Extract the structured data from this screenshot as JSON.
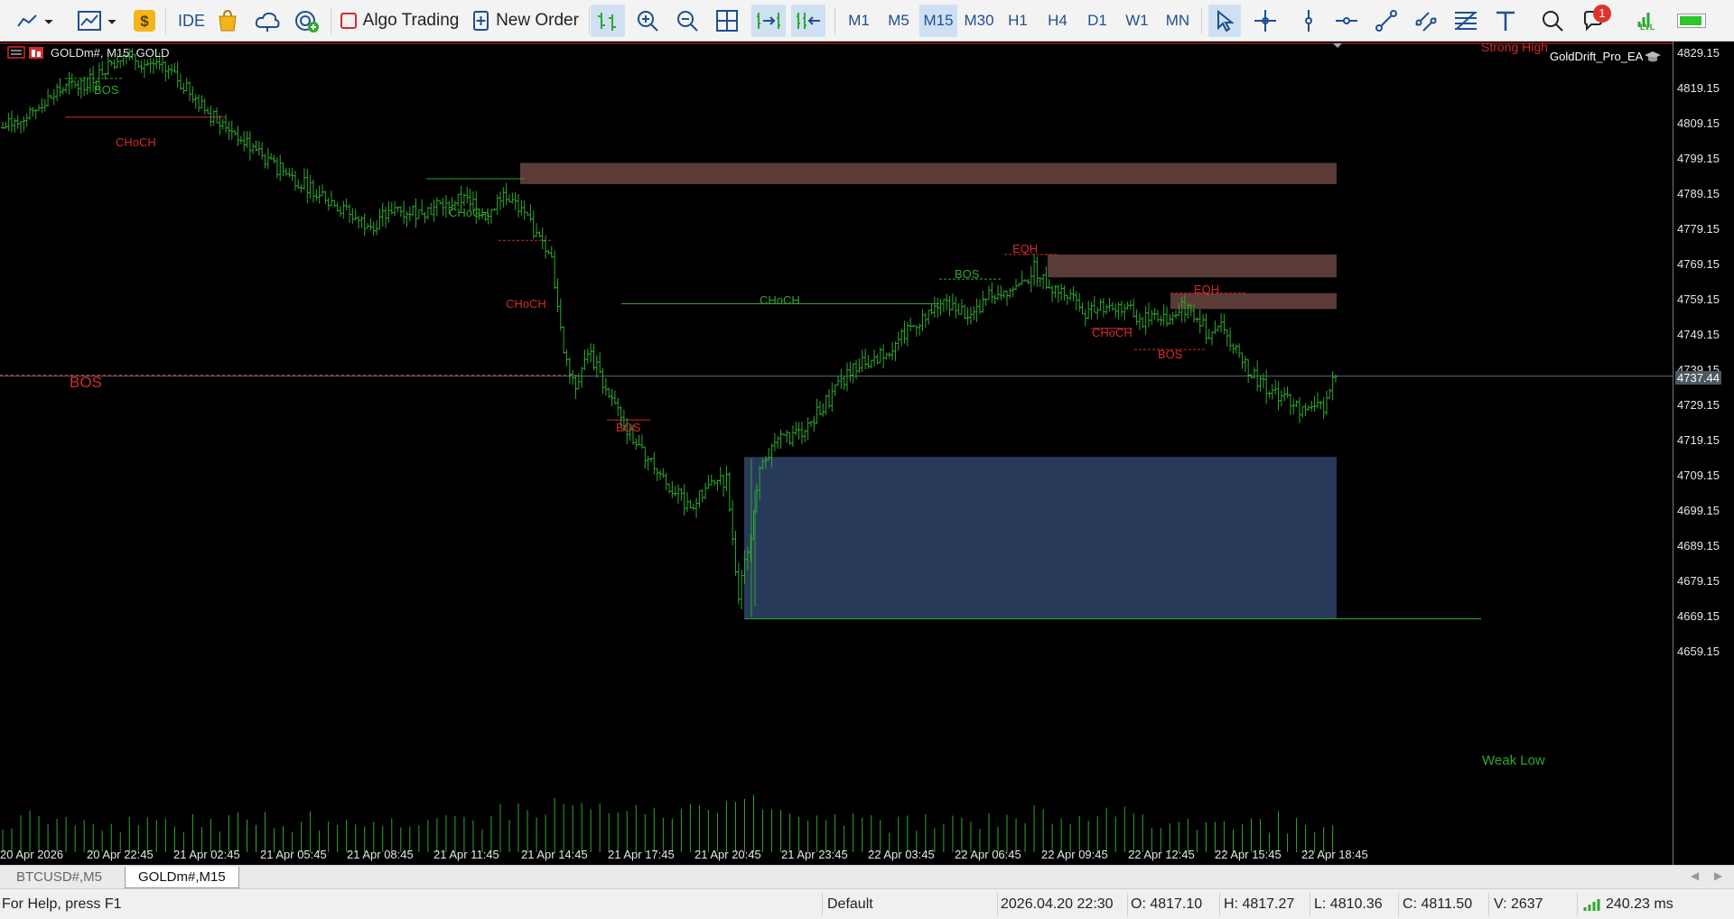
{
  "toolbar": {
    "algo_trading": "Algo Trading",
    "new_order": "New Order",
    "ide": "IDE",
    "timeframes": [
      "M1",
      "M5",
      "M15",
      "M30",
      "H1",
      "H4",
      "D1",
      "W1",
      "MN"
    ],
    "active_timeframe": "M15",
    "notification_count": "1",
    "lvl": "LVL"
  },
  "chart": {
    "title": "GOLDm#, M15:  GOLD",
    "ea_name": "GoldDrift_Pro_EA",
    "strong_high": "Strong High",
    "weak_low": "Weak Low",
    "current_price": "4737.44",
    "bull_color": "#2ea82e",
    "bear_color": "#d42b2b",
    "zone_color": "#5a3b37",
    "demand_zone_color": "#283a5a",
    "labels": {
      "bos": "BOS",
      "choch": "CHoCH",
      "eqh": "EQH"
    }
  },
  "price_scale": [
    "4829.15",
    "4819.15",
    "4809.15",
    "4799.15",
    "4789.15",
    "4779.15",
    "4769.15",
    "4759.15",
    "4749.15",
    "4739.15",
    "4729.15",
    "4719.15",
    "4709.15",
    "4699.15",
    "4689.15",
    "4679.15",
    "4669.15",
    "4659.15"
  ],
  "time_scale": [
    "20 Apr 2026",
    "20 Apr 22:45",
    "21 Apr 02:45",
    "21 Apr 05:45",
    "21 Apr 08:45",
    "21 Apr 11:45",
    "21 Apr 14:45",
    "21 Apr 17:45",
    "21 Apr 20:45",
    "21 Apr 23:45",
    "22 Apr 03:45",
    "22 Apr 06:45",
    "22 Apr 09:45",
    "22 Apr 12:45",
    "22 Apr 15:45",
    "22 Apr 18:45"
  ],
  "tabs": [
    "BTCUSD#,M5",
    "GOLDm#,M15"
  ],
  "active_tab": "GOLDm#,M15",
  "status": {
    "help": "For Help, press F1",
    "profile": "Default",
    "datetime": "2026.04.20 22:30",
    "open": "O: 4817.10",
    "high": "H: 4817.27",
    "low": "L: 4810.36",
    "close": "C: 4811.50",
    "volume": "V: 2637",
    "ping": "240.23 ms"
  },
  "chart_data": {
    "type": "ohlc",
    "symbol": "GOLDm#",
    "timeframe": "M15",
    "ylim": [
      4652,
      4833
    ],
    "close_path": [
      [
        0,
        4808
      ],
      [
        10,
        4813
      ],
      [
        20,
        4819
      ],
      [
        28,
        4821
      ],
      [
        34,
        4825
      ],
      [
        40,
        4829
      ],
      [
        48,
        4826
      ],
      [
        55,
        4824
      ],
      [
        62,
        4818
      ],
      [
        68,
        4812
      ],
      [
        74,
        4809
      ],
      [
        82,
        4803
      ],
      [
        90,
        4797
      ],
      [
        98,
        4793
      ],
      [
        106,
        4789
      ],
      [
        114,
        4784
      ],
      [
        122,
        4780
      ],
      [
        130,
        4785
      ],
      [
        138,
        4784
      ],
      [
        146,
        4786
      ],
      [
        154,
        4788
      ],
      [
        160,
        4783
      ],
      [
        166,
        4790
      ],
      [
        170,
        4786
      ],
      [
        176,
        4779
      ],
      [
        182,
        4770
      ],
      [
        186,
        4745
      ],
      [
        190,
        4735
      ],
      [
        194,
        4745
      ],
      [
        198,
        4738
      ],
      [
        204,
        4727
      ],
      [
        210,
        4718
      ],
      [
        216,
        4712
      ],
      [
        222,
        4705
      ],
      [
        228,
        4700
      ],
      [
        234,
        4706
      ],
      [
        240,
        4708
      ],
      [
        244,
        4675
      ],
      [
        248,
        4693
      ],
      [
        252,
        4715
      ],
      [
        258,
        4719
      ],
      [
        264,
        4721
      ],
      [
        270,
        4727
      ],
      [
        276,
        4733
      ],
      [
        282,
        4740
      ],
      [
        288,
        4742
      ],
      [
        294,
        4745
      ],
      [
        300,
        4750
      ],
      [
        306,
        4755
      ],
      [
        312,
        4758
      ],
      [
        318,
        4756
      ],
      [
        322,
        4754
      ],
      [
        326,
        4760
      ],
      [
        332,
        4762
      ],
      [
        338,
        4763
      ],
      [
        342,
        4768
      ],
      [
        348,
        4763
      ],
      [
        354,
        4760
      ],
      [
        360,
        4755
      ],
      [
        366,
        4758
      ],
      [
        372,
        4757
      ],
      [
        378,
        4753
      ],
      [
        382,
        4756
      ],
      [
        386,
        4752
      ],
      [
        390,
        4757
      ],
      [
        396,
        4755
      ],
      [
        400,
        4748
      ],
      [
        404,
        4752
      ],
      [
        410,
        4744
      ],
      [
        414,
        4738
      ],
      [
        420,
        4733
      ],
      [
        426,
        4731
      ],
      [
        432,
        4727
      ],
      [
        438,
        4729
      ],
      [
        442,
        4738
      ]
    ],
    "volume_max": 65
  }
}
